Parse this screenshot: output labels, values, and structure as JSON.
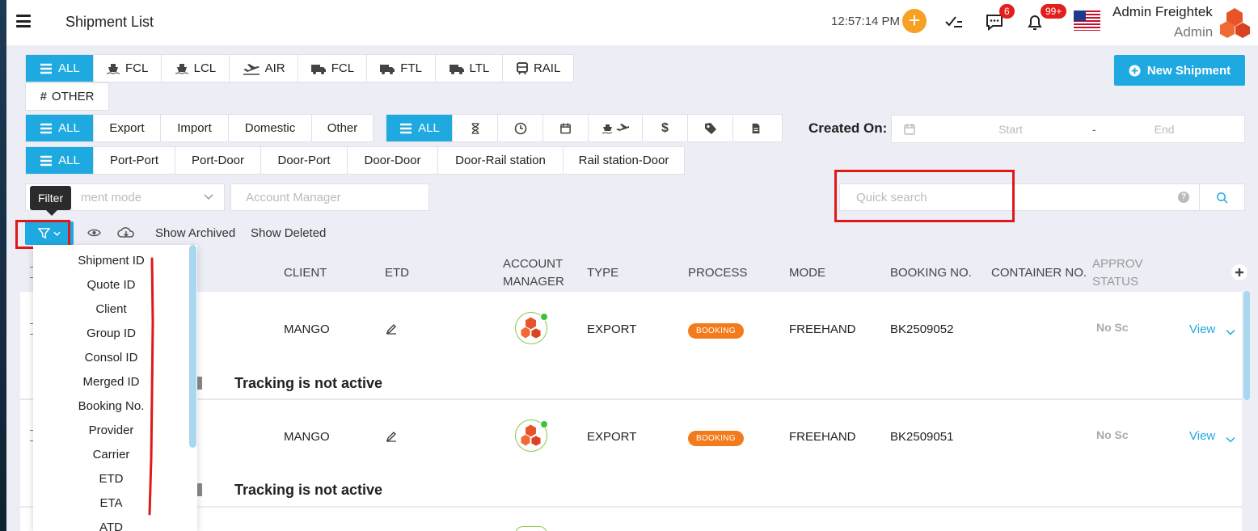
{
  "header": {
    "title": "Shipment List",
    "time": "12:57:14 PM",
    "messages_badge": "6",
    "notifications_badge": "99+",
    "user_name": "Admin Freightek",
    "user_role": "Admin"
  },
  "mode_tabs": [
    {
      "label": "ALL",
      "icon": "list-icon"
    },
    {
      "label": "FCL",
      "icon": "ship-icon"
    },
    {
      "label": "LCL",
      "icon": "ship-icon"
    },
    {
      "label": "AIR",
      "icon": "plane-icon"
    },
    {
      "label": "FCL",
      "icon": "truck-icon"
    },
    {
      "label": "FTL",
      "icon": "truck-icon"
    },
    {
      "label": "LTL",
      "icon": "truck-icon"
    },
    {
      "label": "RAIL",
      "icon": "train-icon"
    }
  ],
  "other_tab": {
    "label": "OTHER",
    "icon": "hash-icon"
  },
  "new_shipment": "New Shipment",
  "direction_tabs": [
    "ALL",
    "Export",
    "Import",
    "Domestic",
    "Other"
  ],
  "status_tabs": {
    "all_label": "ALL",
    "icons": [
      "hourglass-icon",
      "clock-icon",
      "calendar-icon",
      "ship-plane-icon",
      "dollar-icon",
      "tag-icon",
      "document-icon"
    ]
  },
  "created_on": {
    "label": "Created On:",
    "start_placeholder": "Start",
    "separator": "-",
    "end_placeholder": "End"
  },
  "route_tabs": [
    "ALL",
    "Port-Port",
    "Port-Door",
    "Door-Port",
    "Door-Door",
    "Door-Rail station",
    "Rail station-Door"
  ],
  "filters": {
    "shipment_mode_placeholder": "ment mode",
    "account_manager_placeholder": "Account Manager",
    "quick_search_placeholder": "Quick search",
    "tooltip": "Filter"
  },
  "toolbar": {
    "show_archived": "Show Archived",
    "show_deleted": "Show Deleted"
  },
  "columns": {
    "client": "CLIENT",
    "etd": "ETD",
    "account_manager_1": "ACCOUNT",
    "account_manager_2": "MANAGER",
    "type": "TYPE",
    "process": "PROCESS",
    "mode": "MODE",
    "booking_no": "BOOKING NO.",
    "container_no": "CONTAINER NO.",
    "approval_1": "APPROV",
    "approval_2": "STATUS"
  },
  "rows": [
    {
      "client": "MANGO",
      "type": "EXPORT",
      "process": "BOOKING",
      "mode": "FREEHAND",
      "booking_no": "BK2509052",
      "approval": "No Sc",
      "view": "View",
      "tracking": "Tracking is not active"
    },
    {
      "client": "MANGO",
      "type": "EXPORT",
      "process": "BOOKING",
      "mode": "FREEHAND",
      "booking_no": "BK2509051",
      "approval": "No Sc",
      "view": "View",
      "tracking": "Tracking is not active"
    }
  ],
  "filter_menu": [
    "Shipment ID",
    "Quote ID",
    "Client",
    "Group ID",
    "Consol ID",
    "Merged ID",
    "Booking No.",
    "Provider",
    "Carrier",
    "ETD",
    "ETA",
    "ATD"
  ],
  "colors": {
    "accent": "#1fa9e1",
    "orange": "#f47b1b",
    "plus": "#f7a023",
    "badge": "#e41d1d",
    "highlight": "#e01818"
  }
}
